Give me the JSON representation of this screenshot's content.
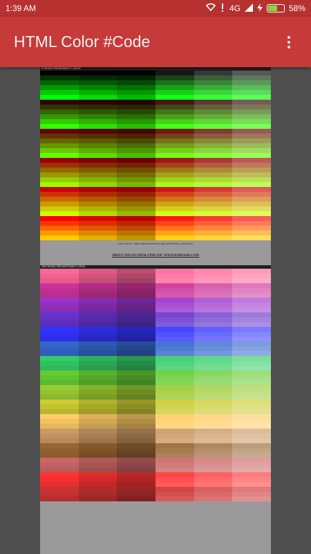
{
  "status_bar": {
    "time": "1:39 AM",
    "network": "4G",
    "battery": "58%",
    "battery_level": 0.58
  },
  "app_bar": {
    "title": "HTML Color #Code"
  },
  "content": {
    "primary_title": "Primary/Mono/Basic Colors",
    "caption": "web source: https://gottroparecom.uploaded/html_colors.htm",
    "developer_link": "ABOUT DEVELOPER FIND ON: WWW.EMRASH.COM",
    "secondary_title": "Secondary/Mixed/Pastel Colors",
    "primary_hues": [
      "#000000",
      "#003300",
      "#006600",
      "#009900",
      "#00cc00",
      "#00ff00",
      "#330000",
      "#333300",
      "#336600",
      "#339900",
      "#33cc00",
      "#33ff00",
      "#660000",
      "#663300",
      "#666600",
      "#669900",
      "#66cc00",
      "#66ff00",
      "#990000",
      "#993300",
      "#996600",
      "#999900",
      "#99cc00",
      "#99ff00",
      "#cc0000",
      "#cc3300",
      "#cc6600",
      "#cc9900",
      "#cccc00",
      "#ccff00",
      "#ff0000",
      "#ff3300",
      "#ff6600",
      "#ff9900",
      "#ffcc00"
    ],
    "secondary_hues": [
      "#ff6699",
      "#cc3399",
      "#9933cc",
      "#6633cc",
      "#3333ff",
      "#3366cc",
      "#33cc66",
      "#66cc33",
      "#99cc33",
      "#cccc33",
      "#ffcc66",
      "#cc9966",
      "#996633",
      "#cc6666",
      "#ff3333",
      "#cc3333"
    ]
  }
}
